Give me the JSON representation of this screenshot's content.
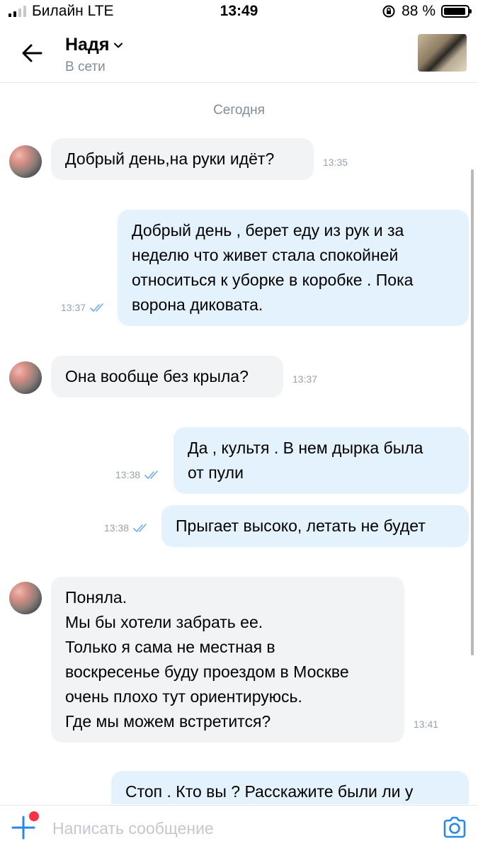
{
  "status_bar": {
    "carrier": "Билайн LTE",
    "time": "13:49",
    "battery": "88 %"
  },
  "header": {
    "name": "Надя",
    "status": "В сети"
  },
  "chat": {
    "date_separator": "Сегодня",
    "messages": [
      {
        "direction": "in",
        "lines": [
          "Добрый день,на руки идёт?"
        ],
        "time": "13:35"
      },
      {
        "direction": "out",
        "lines": [
          "Добрый день , берет еду из рук и за",
          "неделю что живет стала спокойней",
          "относиться к уборке в коробке . Пока",
          "ворона диковата."
        ],
        "time": "13:37",
        "read": true
      },
      {
        "direction": "in",
        "lines": [
          "Она вообще без крыла?"
        ],
        "time": "13:37"
      },
      {
        "direction": "out",
        "lines": [
          "Да , культя . В нем дырка была",
          "от пули"
        ],
        "time": "13:38",
        "read": true
      },
      {
        "direction": "out",
        "lines": [
          "Прыгает высоко, летать не будет"
        ],
        "time": "13:38",
        "read": true
      },
      {
        "direction": "in",
        "lines": [
          "Поняла.",
          "Мы бы хотели забрать ее.",
          "Только я сама не местная в",
          "воскресенье буду проездом в Москве",
          "очень плохо тут ориентируюсь.",
          "Где мы можем встретится?"
        ],
        "time": "13:41"
      },
      {
        "direction": "out",
        "lines": [
          "Стоп . Кто вы ? Расскажите были ли у"
        ],
        "time": ""
      }
    ]
  },
  "composer": {
    "placeholder": "Написать сообщение"
  },
  "colors": {
    "incoming_bubble": "#f2f3f5",
    "outgoing_bubble": "#e4f2fd",
    "accent": "#2688eb",
    "muted_text": "#818c99",
    "notification_dot": "#ff3347"
  },
  "icons": [
    "signal-icon",
    "lock-rotation-icon",
    "battery-icon",
    "back-arrow-icon",
    "chevron-down-icon",
    "read-ticks-icon",
    "plus-icon",
    "camera-icon"
  ]
}
